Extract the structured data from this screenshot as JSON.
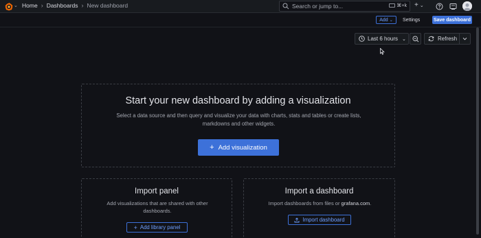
{
  "topbar": {
    "breadcrumb": [
      "Home",
      "Dashboards",
      "New dashboard"
    ],
    "search": {
      "placeholder": "Search or jump to...",
      "shortcut": "⌘+k"
    },
    "plus_label": "+",
    "icons": [
      "grafana-logo-icon",
      "help-icon",
      "news-icon",
      "avatar"
    ]
  },
  "toolbar": {
    "add_label": "Add",
    "settings_label": "Settings",
    "save_label": "Save dashboard"
  },
  "time": {
    "range_label": "Last 6 hours",
    "refresh_label": "Refresh"
  },
  "empty_state": {
    "title": "Start your new dashboard by adding a visualization",
    "description": "Select a data source and then query and visualize your data with charts, stats and tables or create lists, markdowns and other widgets.",
    "button": "Add visualization"
  },
  "import_panel": {
    "title": "Import panel",
    "description": "Add visualizations that are shared with other dashboards.",
    "button": "Add library panel"
  },
  "import_dashboard": {
    "title": "Import a dashboard",
    "description_prefix": "Import dashboards from files or ",
    "description_link": "grafana.com",
    "description_suffix": ".",
    "button": "Import dashboard"
  },
  "colors": {
    "background": "#111217",
    "panel": "#181b1f",
    "primary": "#3d71d9",
    "primary_text": "#6e9fff",
    "brand_orange": "#f46800"
  }
}
